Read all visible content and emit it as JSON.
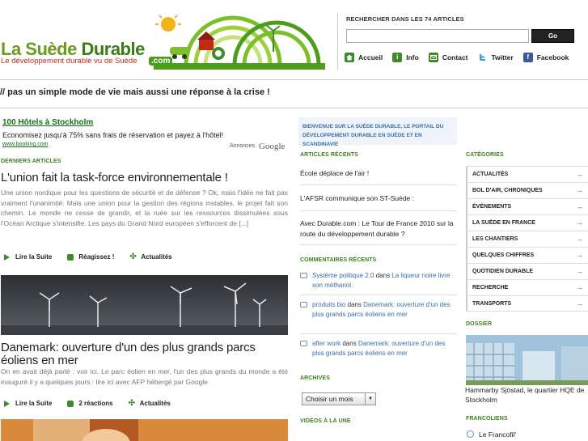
{
  "header": {
    "logo_title_part1": "La Suède",
    "logo_title_part2": "Durable",
    "logo_tagline": "Le développement durable vu de Suède",
    "logo_dotcom": ".com",
    "search_label": "RECHERCHER DANS LES 74 ARTICLES",
    "search_value": "",
    "search_button": "Go",
    "nav": [
      {
        "label": "Accueil",
        "icon": "home-icon"
      },
      {
        "label": "Info",
        "icon": "info-icon"
      },
      {
        "label": "Contact",
        "icon": "mail-icon"
      },
      {
        "label": "Twitter",
        "icon": "twitter-icon"
      },
      {
        "label": "Facebook",
        "icon": "facebook-icon"
      }
    ]
  },
  "slogan": "// pas un simple mode de vie mais aussi une réponse à la crise !",
  "ad": {
    "link": "100 Hôtels à Stockholm",
    "text": "Economisez jusqu'à 75% sans frais de réservation et payez à l'hôtel!",
    "url": "www.booking.com",
    "choices": "Annonces",
    "provider": "Google"
  },
  "latest": {
    "heading": "DERNIERS ARTICLES",
    "articles": [
      {
        "title": "L'union fait la task-force environnementale !",
        "excerpt": "Une union nordique pour les questions de sécurité et de défense ? Ok, mais l'idée ne fait pas vraiment l'unanimité. Mais une union pour la gestion des régions instables, le projet fait son chemin. Le monde ne cesse de grandir, et la ruée sur les ressources dissimulées sous l'Océan Arctique s'intensifie. Les pays du Grand Nord européen s'efforcent de [...]",
        "actions": [
          "Lire la Suite",
          "Réagissez !",
          "Actualités"
        ]
      },
      {
        "title": "Danemark: ouverture d'un des plus grands parcs éoliens en mer",
        "excerpt": "On en avait déjà parlé : voir ici. Le parc éolien en mer, l'un des plus grands du monde a été inauguré il y a quelques jours : lire ici avec AFP hébergé par Google",
        "actions": [
          "Lire la Suite",
          "2 réactions",
          "Actualités"
        ]
      }
    ]
  },
  "welcome": "BIENVENUE SUR LA SUÈDE DURABLE, LE PORTAIL DU DÉVELOPPEMENT DURABLE EN SUÈDE ET EN SCANDINAVIE",
  "recent": {
    "heading": "ARTICLES RÉCENTS",
    "items": [
      "École déplace de l'air !",
      "L'AFSR communique son ST-Suède :",
      "Avec Durable.com : Le Tour de France 2010 sur la route du développement durable ?"
    ]
  },
  "comments": {
    "heading": "COMMENTAIRES RÉCENTS",
    "items": [
      {
        "author": "Système politique 2.0",
        "sep": " dans ",
        "post": "La liqueur noire livre son méthanol."
      },
      {
        "author": "produits bio",
        "sep": " dans ",
        "post": "Danemark: ouverture d'un des plus grands parcs éoliens en mer"
      },
      {
        "author": "after work",
        "sep": " dans ",
        "post": "Danemark: ouverture d'un des plus grands parcs éoliens en mer"
      }
    ]
  },
  "archives": {
    "heading": "ARCHIVES",
    "selected": "Choisir un mois"
  },
  "videos": {
    "heading": "VIDÉOS À LA UNE"
  },
  "categories": {
    "heading": "CATÉGORIES",
    "items": [
      "ACTUALITÉS",
      "BOL D'AIR, CHRONIQUES",
      "ÉVÉNEMENTS",
      "LA SUÈDE EN FRANCE",
      "LES CHANTIERS",
      "QUELQUES CHIFFRES",
      "QUOTIDIEN DURABLE",
      "RECHERCHE",
      "TRANSPORTS"
    ]
  },
  "dossier": {
    "heading": "DOSSIER",
    "caption": "Hammarby Sjöstad, le quartier HQE de Stockholm"
  },
  "francoliens": {
    "heading": "FRANCOLIENS",
    "items": [
      "Le Francofil'"
    ]
  },
  "colors": {
    "brand_green": "#6a9a1f",
    "section_green": "#3f7f1f",
    "tagline_red": "#c02b17",
    "link_blue": "#3a6ea5",
    "welcome_bg": "#eef4f9"
  }
}
